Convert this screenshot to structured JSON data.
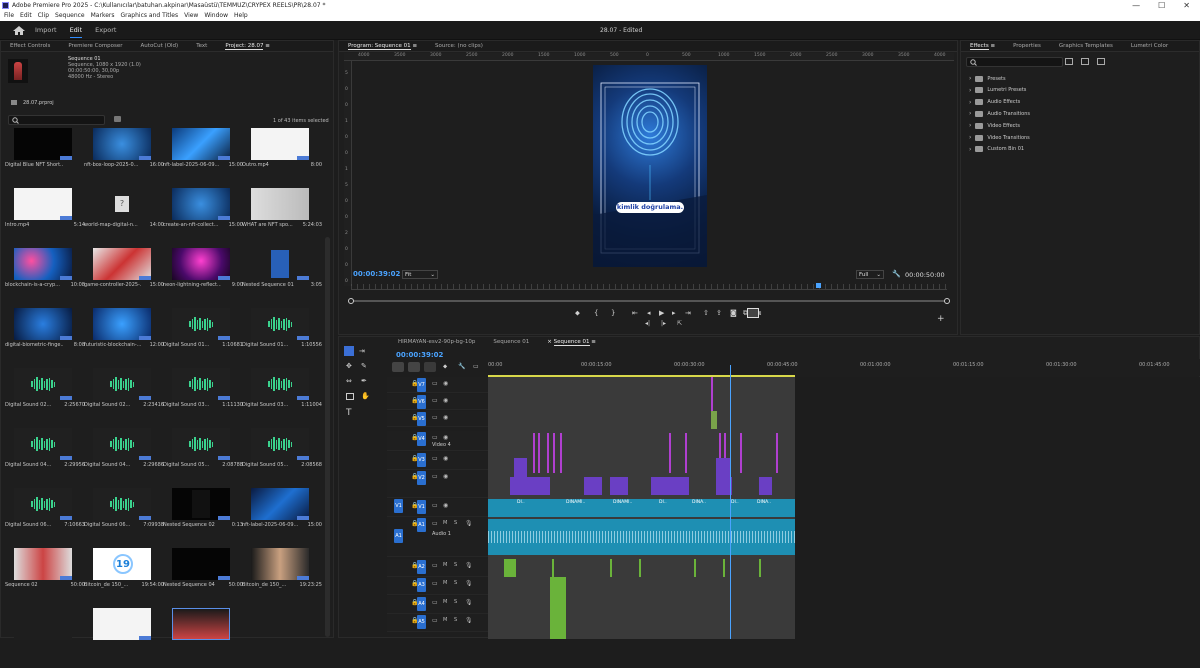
{
  "window": {
    "title": "Adobe Premiere Pro 2025 - C:\\Kullanıcılar\\batuhan.akpinar\\Masaüstü\\TEMMUZ\\CRYPEX REELS\\PR\\28.07 *",
    "minimize": "—",
    "maximize": "☐",
    "close": "✕"
  },
  "menu": [
    "File",
    "Edit",
    "Clip",
    "Sequence",
    "Markers",
    "Graphics and Titles",
    "View",
    "Window",
    "Help"
  ],
  "workspace": {
    "tabs": [
      "Import",
      "Edit",
      "Export"
    ],
    "active": "Edit",
    "doc_title": "28.07 - Edited"
  },
  "left_panel": {
    "tabs": [
      "Effect Controls",
      "Premiere Composer",
      "AutoCut (Old)",
      "Text",
      "Project: 28.07"
    ],
    "seq_name": "Sequence 01",
    "seq_info1": "Sequence, 1080 x 1920 (1.0)",
    "seq_info2": "00:00:50:00, 30,00p",
    "seq_info3": "48000 Hz - Stereo",
    "proj_file": "28.07.prproj",
    "search_placeholder": "",
    "selection": "1 of 43 items selected",
    "items": [
      {
        "name": "Digital Blue NFT Short...",
        "dur": "",
        "kind": "black"
      },
      {
        "name": "nft-box-loop-2025-0...",
        "dur": "16:00",
        "kind": "blue"
      },
      {
        "name": "nft-label-2025-06-09...",
        "dur": "15:00",
        "kind": "blue2"
      },
      {
        "name": "Outro.mp4",
        "dur": "8:00",
        "kind": "white"
      },
      {
        "name": "Intro.mp4",
        "dur": "5:14",
        "kind": "white"
      },
      {
        "name": "world-map-digital-n...",
        "dur": "14:00",
        "kind": "file"
      },
      {
        "name": "create-an-nft-collect...",
        "dur": "15:00",
        "kind": "blue"
      },
      {
        "name": "WHAT are NFT spo...",
        "dur": "5:24:03",
        "kind": "person"
      },
      {
        "name": "blockchain-is-a-cryp...",
        "dur": "10:08",
        "kind": "bokeh"
      },
      {
        "name": "game-controller-2025-...",
        "dur": "15:00",
        "kind": "game"
      },
      {
        "name": "neon-lightning-reflect...",
        "dur": "9:00",
        "kind": "neon"
      },
      {
        "name": "Nested Sequence 01",
        "dur": "3:05",
        "kind": "nested"
      },
      {
        "name": "digital-biometric-finge...",
        "dur": "8:08",
        "kind": "fp"
      },
      {
        "name": "futuristic-blockchain-...",
        "dur": "12:00",
        "kind": "cube"
      },
      {
        "name": "Digital Sound 01...",
        "dur": "1:10681",
        "kind": "audio"
      },
      {
        "name": "Digital Sound 01...",
        "dur": "1:10556",
        "kind": "audio"
      },
      {
        "name": "Digital Sound 02...",
        "dur": "2:25670",
        "kind": "audio"
      },
      {
        "name": "Digital Sound 02...",
        "dur": "2:23416",
        "kind": "audio"
      },
      {
        "name": "Digital Sound 03...",
        "dur": "1:11130",
        "kind": "audio"
      },
      {
        "name": "Digital Sound 03...",
        "dur": "1:11004",
        "kind": "audio"
      },
      {
        "name": "Digital Sound 04...",
        "dur": "2:29956",
        "kind": "audio"
      },
      {
        "name": "Digital Sound 04...",
        "dur": "2:29686",
        "kind": "audio"
      },
      {
        "name": "Digital Sound 05...",
        "dur": "2:08788",
        "kind": "audio"
      },
      {
        "name": "Digital Sound 05...",
        "dur": "2:08568",
        "kind": "audio"
      },
      {
        "name": "Digital Sound 06...",
        "dur": "7:10663",
        "kind": "audio"
      },
      {
        "name": "Digital Sound 06...",
        "dur": "7:09938",
        "kind": "audio"
      },
      {
        "name": "Nested Sequence 02",
        "dur": "0:13",
        "kind": "nested2"
      },
      {
        "name": "nft-label-2025-06-09...",
        "dur": "15:00",
        "kind": "grid"
      },
      {
        "name": "Sequence 02",
        "dur": "50:00",
        "kind": "woman"
      },
      {
        "name": "Bitcoin_de 150_...",
        "dur": "19:54:00",
        "kind": "nineteen"
      },
      {
        "name": "Nested Sequence 04",
        "dur": "50:00",
        "kind": "black"
      },
      {
        "name": "Bitcoin_de 150_...",
        "dur": "19:23:25",
        "kind": "woman2"
      },
      {
        "name": "",
        "dur": "",
        "kind": "blank"
      },
      {
        "name": "",
        "dur": "",
        "kind": "white"
      },
      {
        "name": "",
        "dur": "",
        "kind": "woman3"
      }
    ]
  },
  "program_monitor": {
    "tabs": [
      "Program: Sequence 01",
      "Source: (no clips)"
    ],
    "ruler_ticks": [
      "4000",
      "3500",
      "3000",
      "2500",
      "2000",
      "1500",
      "1000",
      "500",
      "0",
      "500",
      "1000",
      "1500",
      "2000",
      "2500",
      "3000",
      "3500",
      "4000"
    ],
    "vruler_ticks": [
      "5",
      "0",
      "0",
      "1",
      "0",
      "0",
      "1",
      "5",
      "0",
      "0",
      "2",
      "0",
      "0",
      "0"
    ],
    "caption": "kimlik doğrulama.",
    "timecode": "00:00:39:02",
    "fit": "Fit",
    "quality": "Full",
    "duration": "00:00:50:00",
    "playhead_fraction": 0.78,
    "add_button": "+"
  },
  "effects_panel": {
    "tabs": [
      "Effects",
      "Properties",
      "Graphics Templates",
      "Lumetri Color"
    ],
    "items": [
      "Presets",
      "Lumetri Presets",
      "Audio Effects",
      "Audio Transitions",
      "Video Effects",
      "Video Transitions",
      "Custom Bin 01"
    ]
  },
  "timeline": {
    "tabs": [
      "HIRMAYAN-esv2-90p-bg-10p",
      "Sequence 01",
      "Sequence 01"
    ],
    "active_tab": "Sequence 01",
    "timecode": "00:00:39:02",
    "ruler_labels": [
      "00:00",
      "00:00:15:00",
      "00:00:30:00",
      "00:00:45:00",
      "00:01:00:00",
      "00:01:15:00",
      "00:01:30:00",
      "00:01:45:00"
    ],
    "tracks": [
      {
        "id": "V7",
        "label": ""
      },
      {
        "id": "V6",
        "label": ""
      },
      {
        "id": "V5",
        "label": ""
      },
      {
        "id": "V4",
        "label": "Video 4"
      },
      {
        "id": "V3",
        "label": ""
      },
      {
        "id": "V2",
        "label": ""
      },
      {
        "id": "V1",
        "label": ""
      },
      {
        "id": "A1",
        "label": "Audio 1"
      },
      {
        "id": "A2",
        "label": ""
      },
      {
        "id": "A3",
        "label": ""
      },
      {
        "id": "A4",
        "label": ""
      },
      {
        "id": "A5",
        "label": ""
      }
    ],
    "clip_labels": [
      "DI..",
      "DINAMI..",
      "DINAMI..",
      "DI..",
      "DINA..",
      "DI..",
      "DINA.."
    ],
    "playhead_seconds": 39.07
  },
  "colors": {
    "accent": "#2f8cff",
    "timecode": "#4aa3ff",
    "audio_clip": "#1e8fb3",
    "video_clip": "#6a3fc4",
    "magenta_clip": "#b03fd0",
    "green_clip": "#6ab33a"
  }
}
